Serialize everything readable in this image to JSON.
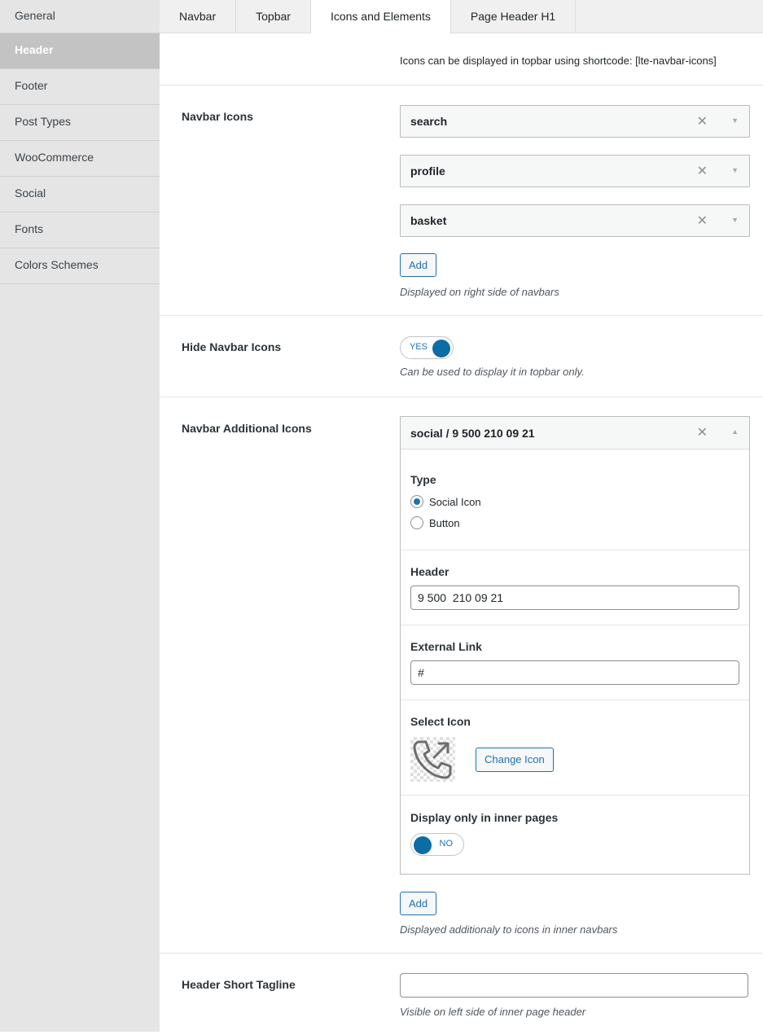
{
  "sidebar": {
    "items": [
      {
        "label": "General"
      },
      {
        "label": "Header"
      },
      {
        "label": "Footer"
      },
      {
        "label": "Post Types"
      },
      {
        "label": "WooCommerce"
      },
      {
        "label": "Social"
      },
      {
        "label": "Fonts"
      },
      {
        "label": "Colors Schemes"
      }
    ],
    "active": "Header"
  },
  "tabs": [
    {
      "label": "Navbar"
    },
    {
      "label": "Topbar"
    },
    {
      "label": "Icons and Elements"
    },
    {
      "label": "Page Header H1"
    }
  ],
  "active_tab": "Icons and Elements",
  "note": "Icons can be displayed in topbar using shortcode: [lte-navbar-icons]",
  "navbar_icons": {
    "label": "Navbar Icons",
    "items": [
      "search",
      "profile",
      "basket"
    ],
    "add_label": "Add",
    "description": "Displayed on right side of navbars"
  },
  "hide_navbar_icons": {
    "label": "Hide Navbar Icons",
    "toggle_text": "YES",
    "description": "Can be used to display it in topbar only."
  },
  "additional_icons": {
    "label": "Navbar Additional Icons",
    "item_title": "social / 9 500 210 09 21",
    "type_label": "Type",
    "type_options": [
      "Social Icon",
      "Button"
    ],
    "type_selected": "Social Icon",
    "header_label": "Header",
    "header_value": "9 500  210 09 21",
    "link_label": "External Link",
    "link_value": "#",
    "select_icon_label": "Select Icon",
    "select_icon_name": "phone-forwarded-icon",
    "change_icon_label": "Change Icon",
    "inner_label": "Display only in inner pages",
    "inner_toggle_text": "NO",
    "add_label": "Add",
    "description": "Displayed additionaly to icons in inner navbars"
  },
  "tagline": {
    "label": "Header Short Tagline",
    "value": "",
    "description": "Visible on left side of inner page header"
  },
  "glyphs": {
    "remove": "✕",
    "caret_down": "▼",
    "caret_up": "▲"
  },
  "colors": {
    "accent": "#2271b1",
    "toggle_knob": "#0a6da5",
    "sidebar_bg": "#e5e5e5",
    "sidebar_active_bg": "#c3c3c3"
  }
}
